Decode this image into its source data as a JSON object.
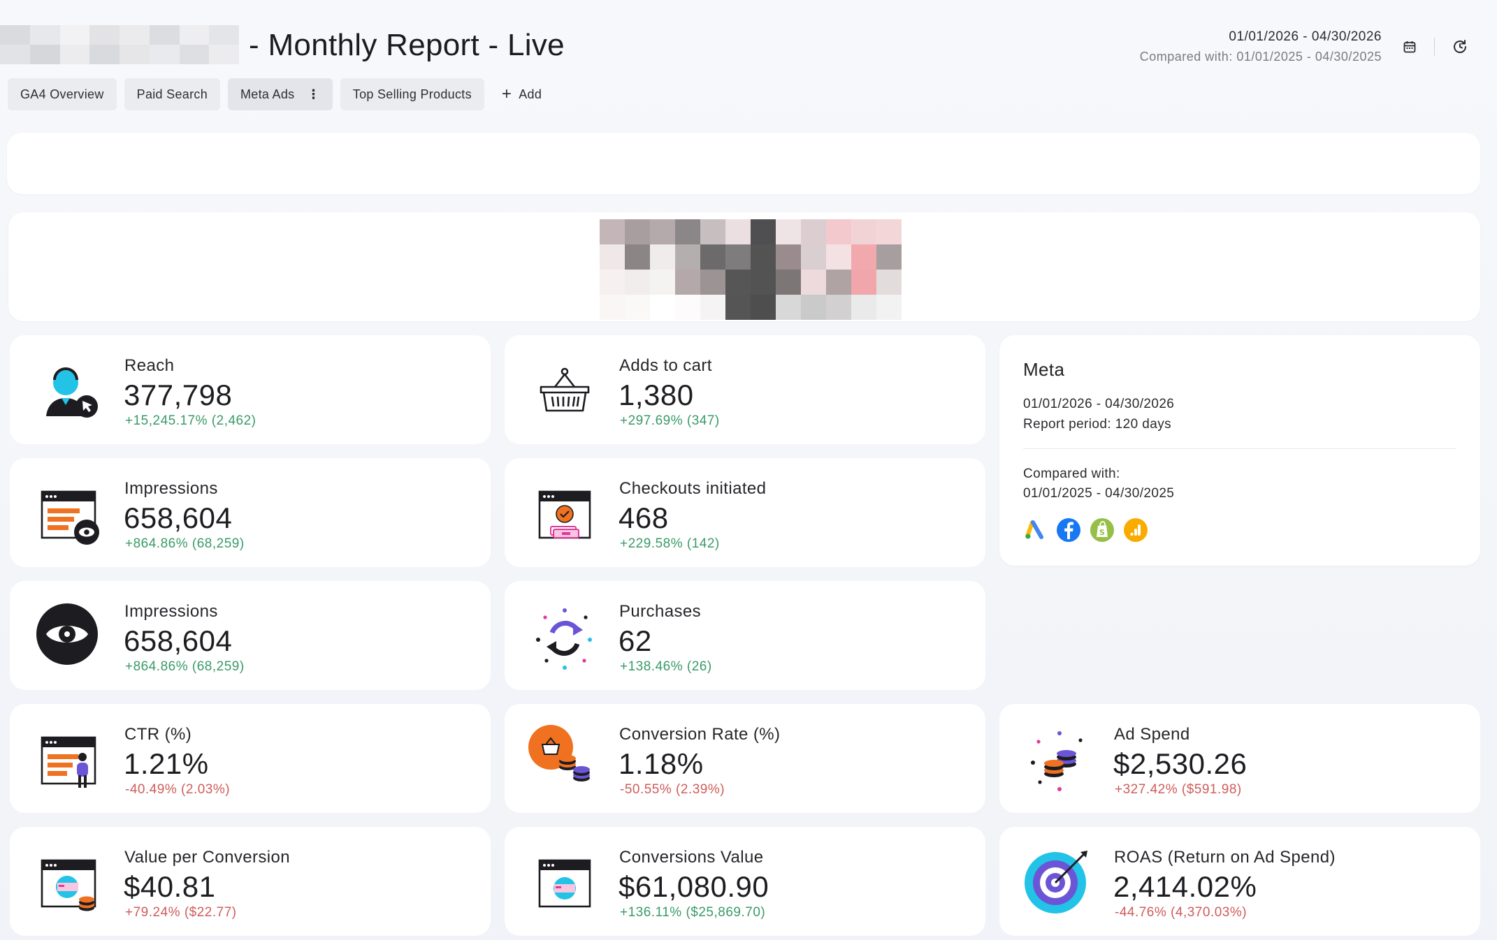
{
  "header": {
    "title": "- Monthly Report - Live",
    "date_range": "01/01/2026 - 04/30/2026",
    "compared": "Compared with: 01/01/2025 - 04/30/2025",
    "calendar_icon": "calendar-icon",
    "refresh_icon": "refresh-icon"
  },
  "tabs": [
    {
      "label": "GA4 Overview"
    },
    {
      "label": "Paid Search"
    },
    {
      "label": "Meta Ads",
      "menu": "⋮"
    },
    {
      "label": "Top Selling Products"
    }
  ],
  "add_tab": {
    "icon": "+",
    "label": "Add"
  },
  "cards": {
    "reach": {
      "label": "Reach",
      "value": "377,798",
      "delta": "+15,245.17% (2,462)"
    },
    "adds_to_cart": {
      "label": "Adds to cart",
      "value": "1,380",
      "delta": "+297.69% (347)"
    },
    "impressions_a": {
      "label": "Impressions",
      "value": "658,604",
      "delta": "+864.86% (68,259)"
    },
    "checkouts": {
      "label": "Checkouts initiated",
      "value": "468",
      "delta": "+229.58% (142)"
    },
    "impressions_b": {
      "label": "Impressions",
      "value": "658,604",
      "delta": "+864.86% (68,259)"
    },
    "purchases": {
      "label": "Purchases",
      "value": "62",
      "delta": "+138.46% (26)"
    },
    "ctr": {
      "label": "CTR (%)",
      "value": "1.21%",
      "delta": "-40.49% (2.03%)"
    },
    "conv_rate": {
      "label": "Conversion Rate (%)",
      "value": "1.18%",
      "delta": "-50.55% (2.39%)"
    },
    "ad_spend": {
      "label": "Ad Spend",
      "value": "$2,530.26",
      "delta": "+327.42% ($591.98)"
    },
    "value_per_conv": {
      "label": "Value per Conversion",
      "value": "$40.81",
      "delta": "+79.24% ($22.77)"
    },
    "conv_value": {
      "label": "Conversions Value",
      "value": "$61,080.90",
      "delta": "+136.11% ($25,869.70)"
    },
    "roas": {
      "label": "ROAS (Return on Ad Spend)",
      "value": "2,414.02%",
      "delta": "-44.76% (4,370.03%)"
    }
  },
  "meta": {
    "title": "Meta",
    "range": "01/01/2026 - 04/30/2026",
    "period": "Report period:  120 days",
    "compared_label": "Compared with:",
    "compared_range": "01/01/2025 - 04/30/2025",
    "sources": [
      "google-ads-icon",
      "facebook-icon",
      "shopify-icon",
      "google-analytics-icon"
    ]
  },
  "colors": {
    "positive": "#3a9a68",
    "negative": "#d05b5b",
    "accent_orange": "#f0711f",
    "accent_cyan": "#22c3e6",
    "accent_purple": "#6b55d6"
  }
}
